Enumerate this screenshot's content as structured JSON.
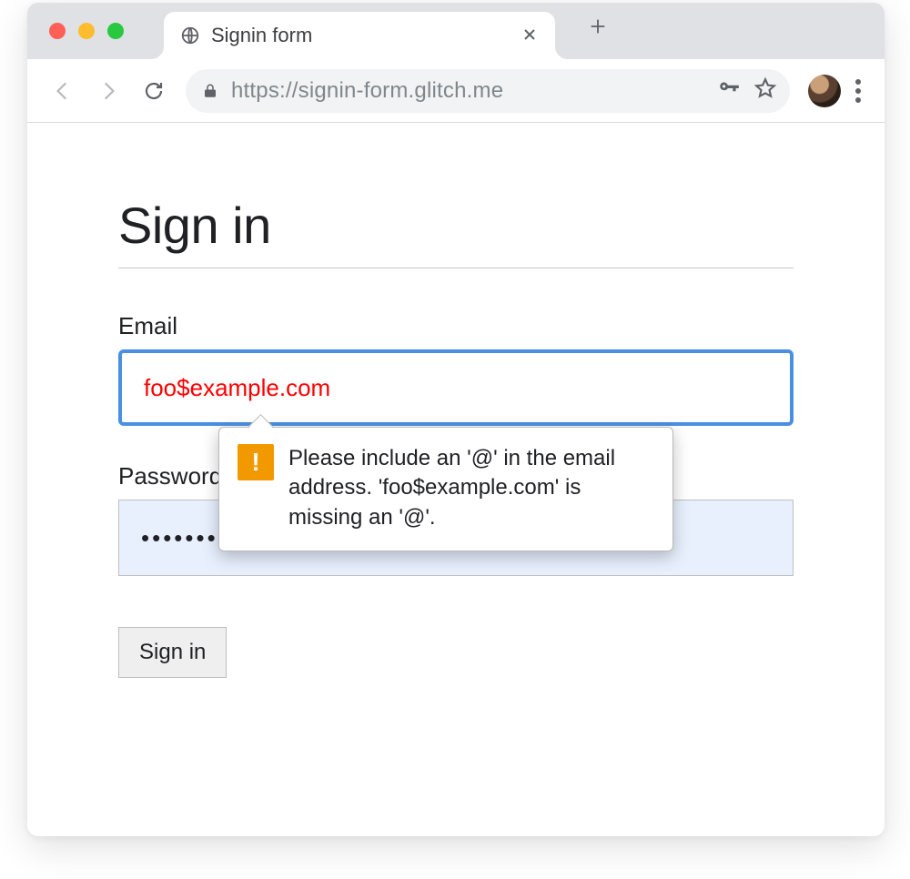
{
  "browser": {
    "tab_title": "Signin form",
    "url": "https://signin-form.glitch.me"
  },
  "page": {
    "heading": "Sign in",
    "email_label": "Email",
    "email_value": "foo$example.com",
    "password_label": "Password",
    "password_value": "••••••••••",
    "submit_label": "Sign in"
  },
  "validation": {
    "message": "Please include an '@' in the email address. 'foo$example.com' is missing an '@'."
  }
}
